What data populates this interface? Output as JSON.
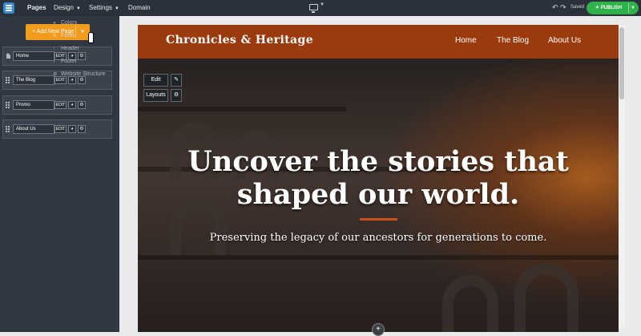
{
  "topbar": {
    "nav": [
      "Pages",
      "Design",
      "Settings",
      "Domain"
    ],
    "saved": "Saved",
    "publish": "PUBLISH"
  },
  "sidebar": {
    "add_page": "Add New Page",
    "pages": [
      {
        "label": "Home",
        "edit": "EDIT"
      },
      {
        "label": "The Blog",
        "edit": "EDIT"
      },
      {
        "label": "Promo",
        "edit": "EDIT"
      },
      {
        "label": "About Us",
        "edit": "EDIT"
      }
    ]
  },
  "design_menu": {
    "items": [
      "Colors",
      "Fonts",
      "Header",
      "Footer",
      "Website Structure"
    ],
    "highlighted": "Fonts"
  },
  "site": {
    "title": "Chronicles & Heritage",
    "nav": [
      "Home",
      "The Blog",
      "About Us"
    ],
    "hero_heading_1": "Uncover the stories that",
    "hero_heading_2": "shaped our world.",
    "hero_sub": "Preserving the legacy of our ancestors for generations to come.",
    "tools": {
      "edit": "Edit",
      "layouts": "Layouts"
    }
  },
  "icons": [
    "logo-icon",
    "desktop-icon",
    "undo-icon",
    "redo-icon",
    "megaphone-icon",
    "home-icon",
    "drag-handle-icon",
    "palette-icon",
    "gear-icon",
    "pen-icon",
    "plus-icon"
  ],
  "colors": {
    "accent_orange": "#f29b1d",
    "publish_green": "#2fb24a",
    "header_rust": "#9a3a0d",
    "topbar": "#2a313a"
  }
}
